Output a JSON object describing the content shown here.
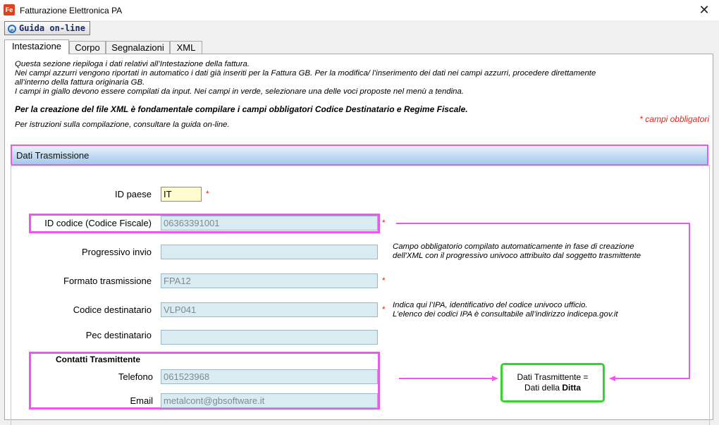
{
  "window": {
    "app_icon": "Fe",
    "title": "Fatturazione Elettronica PA",
    "close_glyph": "✕"
  },
  "toolbar": {
    "guide_icon": "e",
    "guide_label": "Guida on-line"
  },
  "tabs": [
    {
      "label": "Intestazione"
    },
    {
      "label": "Corpo"
    },
    {
      "label": "Segnalazioni"
    },
    {
      "label": "XML"
    }
  ],
  "intro": {
    "line1": "Questa sezione riepiloga i dati relativi all’Intestazione della fattura.",
    "line2": "Nei campi azzurri vengono riportati in automatico i dati già inseriti per la Fattura GB. Per la modifica/ l’inserimento dei dati nei campi azzurri, procedere direttamente",
    "line3": "all’interno della fattura originaria GB.",
    "line4": "I campi in giallo devono essere compilati da input. Nei campi in verde, selezionare una delle voci proposte nel menù a tendina.",
    "bold_line": "Per la creazione del file XML è fondamentale compilare i campi obbligatori Codice Destinatario e Regime Fiscale.",
    "guide_line": "Per istruzioni sulla compilazione, consultare la guida on-line."
  },
  "section": {
    "title": "Dati Trasmissione",
    "required_note": "* campi obbligatori"
  },
  "fields": {
    "id_paese": {
      "label": "ID paese",
      "value": "IT",
      "required": "*"
    },
    "id_codice": {
      "label": "ID codice (Codice Fiscale)",
      "value": "06363391001",
      "required": "*"
    },
    "progressivo": {
      "label": "Progressivo invio",
      "value": ""
    },
    "formato": {
      "label": "Formato trasmissione",
      "value": "FPA12",
      "required": "*"
    },
    "codice_dest": {
      "label": "Codice destinatario",
      "value": "VLP041",
      "required": "*"
    },
    "pec": {
      "label": "Pec destinatario",
      "value": ""
    },
    "contatti_title": "Contatti Trasmittente",
    "telefono": {
      "label": "Telefono",
      "value": "061523968"
    },
    "email": {
      "label": "Email",
      "value": "metalcont@gbsoftware.it"
    }
  },
  "hints": {
    "progressivo_1": "Campo obbligatorio compilato automaticamente in fase di creazione",
    "progressivo_2": "dell'XML con il progressivo univoco attribuito dal soggetto trasmittente",
    "codice_1": "Indica qui l’IPA, identificativo del codice univoco ufficio.",
    "codice_2": "L’elenco dei codici IPA è consultabile all’indirizzo indicepa.gov.it"
  },
  "callout": {
    "line1": "Dati Trasmittente =",
    "line2_prefix": "Dati della ",
    "line2_bold": "Ditta"
  },
  "colors": {
    "highlight": "#ee57ee",
    "callout_border": "#35d32e",
    "required": "#e3251b",
    "auto_field": "#d8ecf1",
    "input_field": "#fffcd0"
  }
}
